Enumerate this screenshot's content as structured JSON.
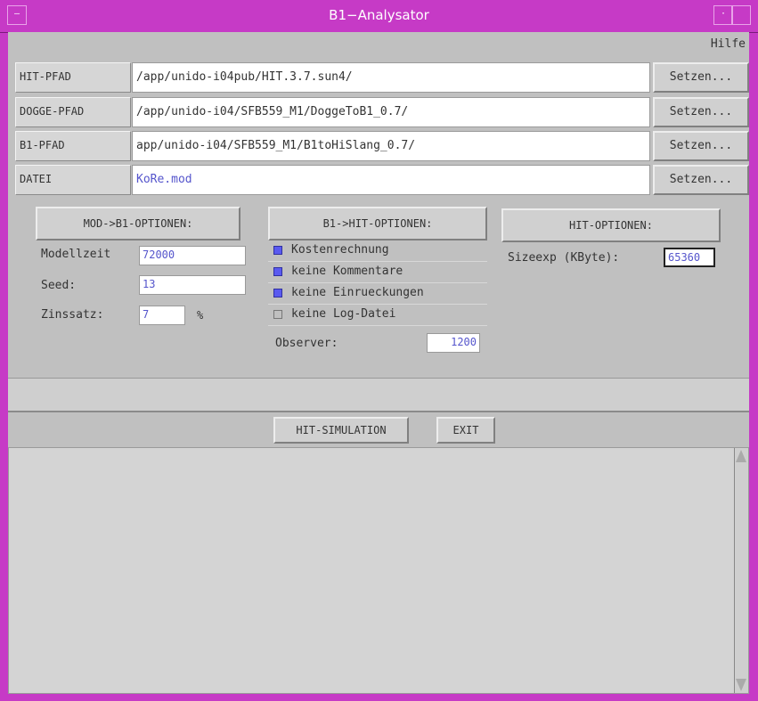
{
  "window": {
    "title": "B1−Analysator"
  },
  "menu": {
    "help": "Hilfe"
  },
  "paths": [
    {
      "label": "HIT-PFAD",
      "value": "/app/unido-i04pub/HIT.3.7.sun4/",
      "button": "Setzen..."
    },
    {
      "label": "DOGGE-PFAD",
      "value": "/app/unido-i04/SFB559_M1/DoggeToB1_0.7/",
      "button": "Setzen..."
    },
    {
      "label": "B1-PFAD",
      "value": "app/unido-i04/SFB559_M1/B1toHiSlang_0.7/",
      "button": "Setzen..."
    },
    {
      "label": "DATEI",
      "value": "KoRe.mod",
      "button": "Setzen..."
    }
  ],
  "mod_options": {
    "title": "MOD->B1-OPTIONEN:",
    "modellzeit_label": "Modellzeit",
    "modellzeit_value": "72000",
    "seed_label": "Seed:",
    "seed_value": "13",
    "zinssatz_label": "Zinssatz:",
    "zinssatz_value": "7",
    "zinssatz_unit": "%"
  },
  "b1_options": {
    "title": "B1->HIT-OPTIONEN:",
    "checks": [
      {
        "label": "Kostenrechnung",
        "checked": true
      },
      {
        "label": "keine Kommentare",
        "checked": true
      },
      {
        "label": "keine Einrueckungen",
        "checked": true
      },
      {
        "label": "keine Log-Datei",
        "checked": false
      }
    ],
    "observer_label": "Observer:",
    "observer_value": "1200"
  },
  "hit_options": {
    "title": "HIT-OPTIONEN:",
    "sizeexp_label": "Sizeexp (KByte):",
    "sizeexp_value": "65360"
  },
  "actions": {
    "simulate": "HIT-SIMULATION",
    "exit": "EXIT"
  },
  "colors": {
    "frame": "#c63ac6",
    "accent": "#5a5af0"
  }
}
